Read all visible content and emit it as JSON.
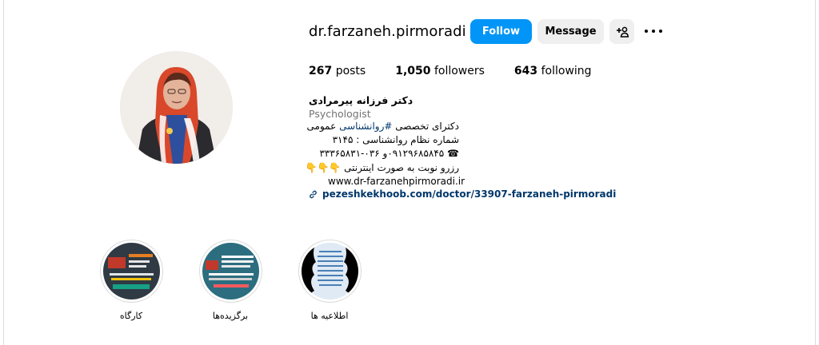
{
  "profile": {
    "username": "dr.farzaneh.pirmoradi",
    "follow_label": "Follow",
    "message_label": "Message",
    "stats": {
      "posts_count": "267",
      "posts_label": "posts",
      "followers_count": "1,050",
      "followers_label": "followers",
      "following_count": "643",
      "following_label": "following"
    },
    "bio": {
      "name": "دکتر فرزانه پیرمرادی",
      "category": "Psychologist",
      "line1_pre": "دکترای تخصصی ",
      "line1_tag": "#روانشناسی",
      "line1_post": " عمومی",
      "line2": "شماره نظام روانشناسی : ۳۱۴۵",
      "line3": "☎ ۰۹۱۲۹۶۸۵۸۴۵و ۰۳۶-۳۳۳۶۵۸۳۱",
      "line4": "رزرو نوبت به صورت اینترنتی 👇👇👇",
      "website": "www.dr-farzanehpirmoradi.ir",
      "link": "pezeshkekhoob.com/doctor/33907-farzaneh-pirmoradi"
    }
  },
  "highlights": [
    {
      "label": "کارگاه"
    },
    {
      "label": "برگزیده‌ها"
    },
    {
      "label": "اطلاعیه ها"
    }
  ],
  "colors": {
    "follow_button": "#0095f6",
    "secondary_button": "#efefef",
    "link": "#00376b",
    "muted_text": "#737373"
  }
}
